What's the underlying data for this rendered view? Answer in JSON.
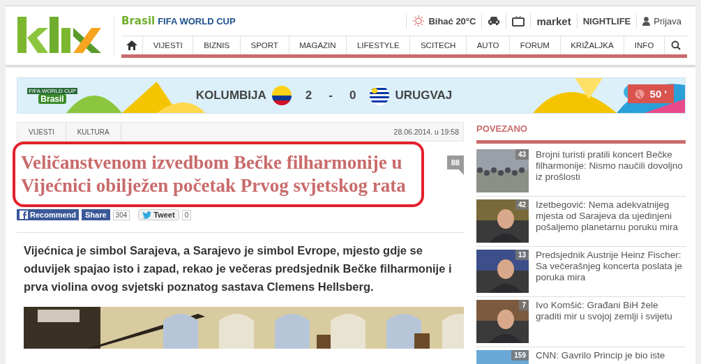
{
  "header": {
    "brand": "Brasil",
    "brand_tag": "FIFA WORLD CUP",
    "weather": "Bihać 20°C",
    "links": [
      {
        "kind": "car"
      },
      {
        "kind": "tv"
      },
      {
        "kind": "text",
        "label": "market"
      },
      {
        "kind": "text",
        "label": "NIGHTLIFE"
      },
      {
        "kind": "user",
        "label": "Prijava"
      }
    ]
  },
  "nav": {
    "items": [
      {
        "label": "VIJESTI"
      },
      {
        "label": "BIZNIS"
      },
      {
        "label": "SPORT"
      },
      {
        "label": "MAGAZIN"
      },
      {
        "label": "LIFESTYLE"
      },
      {
        "label": "SCITECH"
      },
      {
        "label": "AUTO"
      },
      {
        "label": "FORUM"
      },
      {
        "label": "KRIŽALJKA"
      },
      {
        "label": "INFO"
      }
    ]
  },
  "match": {
    "logo_top": "FIFA WORLD CUP",
    "logo_bottom": "Brasil",
    "home": "KOLUMBIJA",
    "home_score": "2",
    "separator": "-",
    "away_score": "0",
    "away": "URUGVAJ",
    "minute": "50 '"
  },
  "article": {
    "breadcrumbs": [
      "VIJESTI",
      "KULTURA"
    ],
    "date": "28.06.2014. u 19:58",
    "title": "Veličanstvenom izvedbom Bečke filharmonije u Vijećnici obilježen početak Prvog svjetskog rata",
    "comments": "88",
    "social": {
      "recommend": "Recommend",
      "share": "Share",
      "share_count": "304",
      "tweet": "Tweet",
      "tweet_count": "0"
    },
    "lead": "Vijećnica je simbol Sarajeva, a Sarajevo je simbol Evrope, mjesto gdje se oduvijek spajao isto i zapad, rekao je večeras predsjednik Bečke filharmonije i prva violina ovog svjetski poznatog sastava Clemens Hellsberg."
  },
  "related": {
    "title": "POVEZANO",
    "items": [
      {
        "count": "43",
        "title": "Brojni turisti pratili koncert Bečke filharmonije: Nismo naučili dovoljno iz prošlosti"
      },
      {
        "count": "42",
        "title": "Izetbegović: Nema adekvatnijeg mjesta od Sarajeva da ujedinjeni pošaljemo planetarnu poruku mira"
      },
      {
        "count": "13",
        "title": "Predsjednik Austrije Heinz Fischer: Sa večerašnjeg koncerta poslata je poruka mira"
      },
      {
        "count": "7",
        "title": "Ivo Komšić: Građani BiH žele graditi mir u svojoj zemlji i svijetu"
      },
      {
        "count": "159",
        "title": "CNN: Gavrilo Princip je bio iste"
      }
    ]
  }
}
